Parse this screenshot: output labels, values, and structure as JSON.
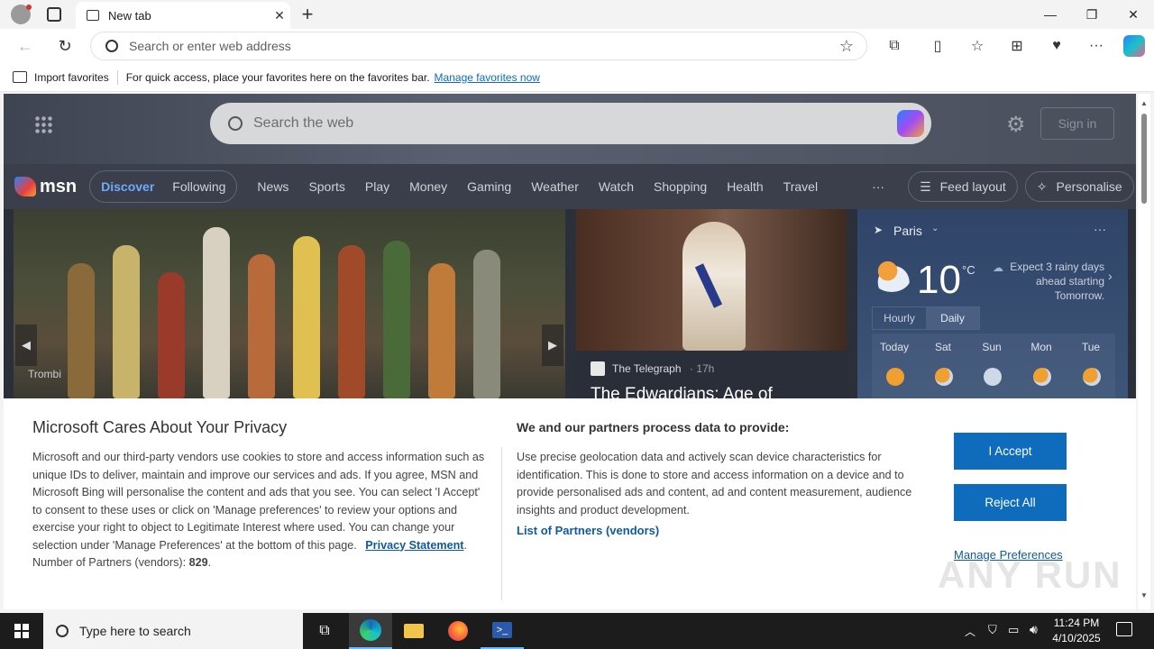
{
  "browser": {
    "tab_title": "New tab",
    "address_placeholder": "Search or enter web address",
    "favorites": {
      "import_label": "Import favorites",
      "hint": "For quick access, place your favorites here on the favorites bar.",
      "manage_link": "Manage favorites now"
    }
  },
  "msn": {
    "search_placeholder": "Search the web",
    "sign_in": "Sign in",
    "logo": "msn",
    "nav": {
      "discover": "Discover",
      "following": "Following",
      "items": [
        "News",
        "Sports",
        "Play",
        "Money",
        "Gaming",
        "Weather",
        "Watch",
        "Shopping",
        "Health",
        "Travel"
      ],
      "more": "···",
      "feed_layout": "Feed layout",
      "personalise": "Personalise"
    },
    "card1": {
      "source": "Trombi"
    },
    "card2": {
      "source": "The Telegraph",
      "age": "· 17h",
      "headline": "The Edwardians: Age of"
    },
    "weather": {
      "location": "Paris",
      "temp": "10",
      "unit": "°C",
      "summary": "Expect 3 rainy days ahead starting Tomorrow.",
      "tab_hourly": "Hourly",
      "tab_daily": "Daily",
      "days": [
        "Today",
        "Sat",
        "Sun",
        "Mon",
        "Tue"
      ]
    }
  },
  "consent": {
    "title": "Microsoft Cares About Your Privacy",
    "body": "Microsoft and our third-party vendors use cookies to store and access information such as unique IDs to deliver, maintain and improve our services and ads. If you agree, MSN and Microsoft Bing will personalise the content and ads that you see. You can select 'I Accept' to consent to these uses or click on 'Manage preferences' to review your options and exercise your right to object to Legitimate Interest where used.  You can change your selection under 'Manage Preferences' at the bottom of this page.",
    "privacy_link": "Privacy Statement",
    "partners_label": "Number of Partners (vendors):",
    "partners_count": "829",
    "title2": "We and our partners process data to provide:",
    "body2": "Use precise geolocation data and actively scan device characteristics for identification. This is done to store and access information on a device and to provide personalised ads and content, ad and content measurement, audience insights and product development.",
    "partners_link": "List of Partners (vendors)",
    "accept": "I Accept",
    "reject": "Reject All",
    "manage": "Manage Preferences"
  },
  "watermark": "ANY RUN",
  "taskbar": {
    "search_placeholder": "Type here to search",
    "time": "11:24 PM",
    "date": "4/10/2025"
  }
}
